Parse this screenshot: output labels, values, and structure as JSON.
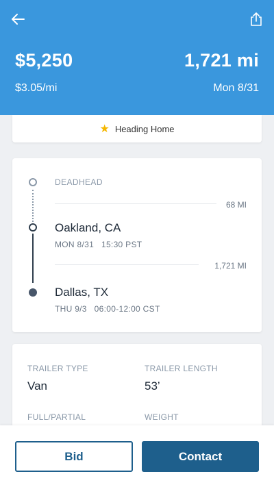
{
  "header": {
    "price": "$5,250",
    "distance": "1,721 mi",
    "rate": "$3.05/mi",
    "date": "Mon 8/31"
  },
  "status": {
    "label": "Heading Home"
  },
  "route": {
    "deadhead_label": "DEADHEAD",
    "deadhead_miles": "68 MI",
    "origin_city": "Oakland, CA",
    "origin_time": "MON 8/31   15:30 PST",
    "trip_miles": "1,721 MI",
    "destination_city": "Dallas, TX",
    "destination_time": "THU 9/3   06:00-12:00 CST"
  },
  "details": {
    "trailer_type_label": "TRAILER TYPE",
    "trailer_type_value": "Van",
    "trailer_length_label": "TRAILER LENGTH",
    "trailer_length_value": "53’",
    "full_partial_label": "FULL/PARTIAL",
    "weight_label": "WEIGHT"
  },
  "actions": {
    "bid_label": "Bid",
    "contact_label": "Contact"
  },
  "colors": {
    "header_bg": "#3a97dd",
    "primary": "#1e5f8c",
    "star": "#f5b700"
  },
  "icons": {
    "back": "arrow-left-icon",
    "share": "share-icon",
    "status": "star-icon"
  }
}
